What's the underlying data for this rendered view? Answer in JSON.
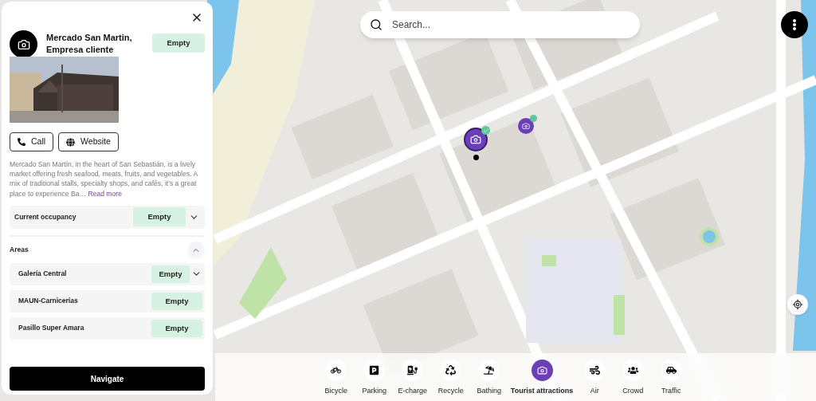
{
  "panel": {
    "title": "Mercado San Martin, Empresa cliente",
    "status": "Empty",
    "actions": [
      {
        "label": "Call"
      },
      {
        "label": "Website"
      }
    ],
    "description": "Mercado San Martín, in the heart of San Sebastián, is a lively market offering fresh seafood, meats, fruits, and vegetables. A mix of traditional stalls, specialty shops, and cafés, it’s a great place to experience Ba…",
    "read_more": "Read more",
    "occupancy": {
      "label": "Current occupancy",
      "status": "Empty",
      "expanded": false
    },
    "areas": {
      "title": "Areas",
      "expanded": true,
      "items": [
        {
          "name": "Galería Central",
          "status": "Empty",
          "expandable": true
        },
        {
          "name": "MAUN-Carnicerías",
          "status": "Empty",
          "expandable": false
        },
        {
          "name": "Pasillo Super Amara",
          "status": "Empty",
          "expandable": false
        }
      ]
    },
    "navigate": "Navigate"
  },
  "search": {
    "placeholder": "Search..."
  },
  "categories": [
    {
      "label": "Bicycle",
      "selected": false
    },
    {
      "label": "Parking",
      "selected": false
    },
    {
      "label": "E-charge",
      "selected": false
    },
    {
      "label": "Recycle",
      "selected": false
    },
    {
      "label": "Bathing",
      "selected": false
    },
    {
      "label": "Tourist attractions",
      "selected": true
    },
    {
      "label": "Air",
      "selected": false
    },
    {
      "label": "Crowd",
      "selected": false
    },
    {
      "label": "Traffic",
      "selected": false
    }
  ]
}
